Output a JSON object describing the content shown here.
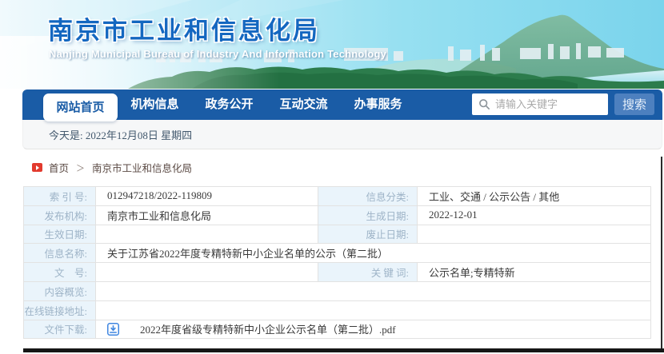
{
  "header": {
    "title": "南京市工业和信息化局",
    "subtitle": "Nanjing Municipal Bureau of Industry And Information Technology"
  },
  "nav": {
    "tabs": [
      {
        "label": "网站首页",
        "active": true
      },
      {
        "label": "机构信息",
        "active": false
      },
      {
        "label": "政务公开",
        "active": false
      },
      {
        "label": "互动交流",
        "active": false
      },
      {
        "label": "办事服务",
        "active": false
      }
    ],
    "search": {
      "placeholder": "请输入关键字",
      "button_label": "搜索",
      "icon": "search-icon"
    },
    "date_line": "今天是: 2022年12月08日 星期四"
  },
  "breadcrumb": {
    "icon": "red-arrow-square-icon",
    "home": "首页",
    "separator": "＞",
    "current": "南京市工业和信息化局"
  },
  "table": {
    "rows": [
      {
        "label": "索 引 号:",
        "value": "012947218/2022-119809",
        "label2": "信息分类:",
        "value2": "工业、交通 / 公示公告 / 其他"
      },
      {
        "label": "发布机构:",
        "value": "南京市工业和信息化局",
        "label2": "生成日期:",
        "value2": "2022-12-01"
      },
      {
        "label": "生效日期:",
        "value": "",
        "label2": "废止日期:",
        "value2": ""
      },
      {
        "label": "信息名称:",
        "value": "关于江苏省2022年度专精特新中小企业名单的公示（第二批）"
      },
      {
        "label": "文　号:",
        "value": "",
        "label2": "关 键 词:",
        "value2": "公示名单;专精特新"
      },
      {
        "label": "内容概览:",
        "value": ""
      },
      {
        "label": "在线链接地址:",
        "value": ""
      },
      {
        "label": "文件下载:",
        "file": "2022年度省级专精特新中小企业公示名单（第二批）.pdf",
        "icon": "download-icon"
      }
    ]
  },
  "colors": {
    "nav_blue": "#1a5ca6",
    "search_button_blue": "#4d80bf",
    "label_cell_bg": "#eaf4fb",
    "label_text": "#9db3c7",
    "value_text": "#3a3a3a",
    "title_blue": "#1467c0",
    "breadcrumb_icon_red": "#e23a2e",
    "download_icon_blue": "#3f86e0",
    "table_border": "#e2e2e2"
  }
}
